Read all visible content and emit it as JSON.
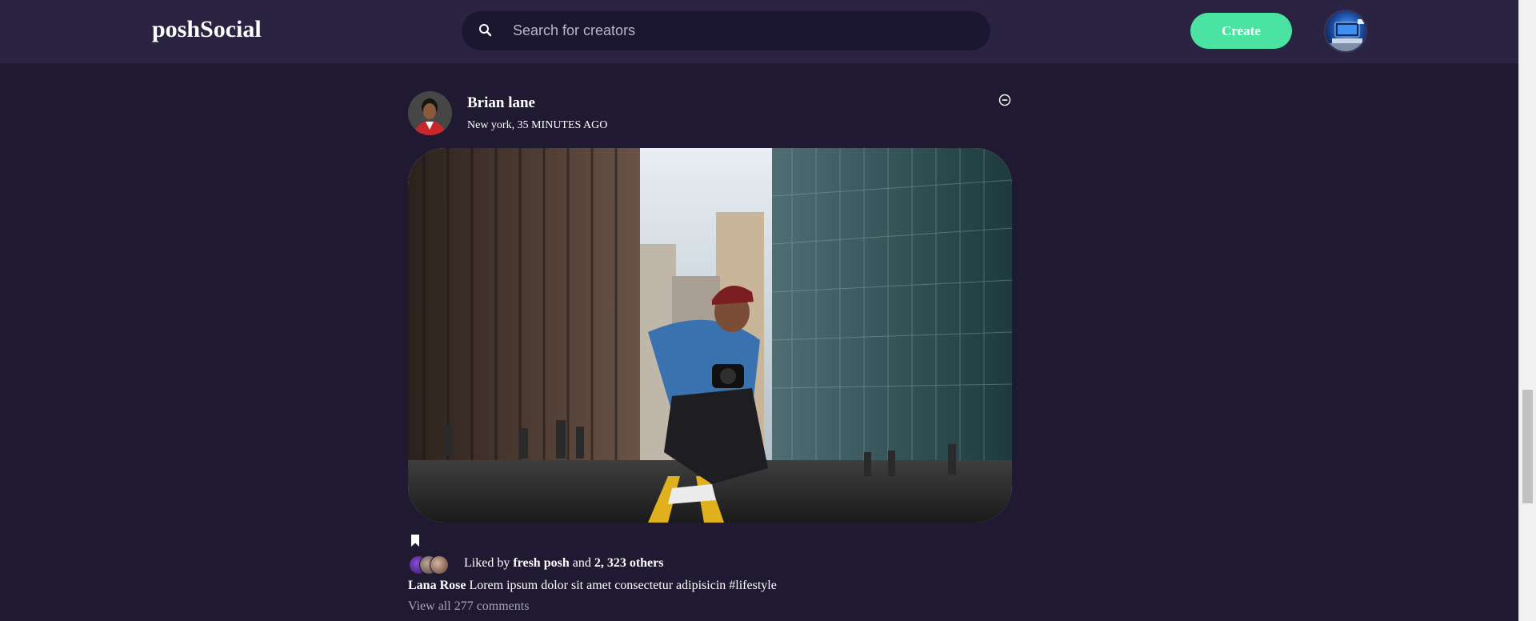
{
  "header": {
    "logo": "poshSocial",
    "search_placeholder": "Search for creators",
    "create_label": "Create",
    "icons": {
      "search": "search-icon",
      "avatar": "user-avatar"
    }
  },
  "post": {
    "author": "Brian lane",
    "location_time": "New york, 35 MINUTES AGO",
    "options_icon": "minus-circle-icon",
    "bookmark_icon": "bookmark-icon",
    "likes": {
      "prefix": "Liked by",
      "first_liker": "fresh posh",
      "connector": "and",
      "others": "2, 323 others"
    },
    "caption": {
      "user": "Lana Rose",
      "text": "Lorem ipsum dolor sit amet consectetur adipisicin #lifestyle"
    },
    "view_comments": "View all 277 comments"
  },
  "colors": {
    "background": "#1f1931",
    "navbar": "#2a2442",
    "search_bg": "#1c1730",
    "accent": "#4be3a2",
    "muted_text": "#a7a4b4"
  }
}
